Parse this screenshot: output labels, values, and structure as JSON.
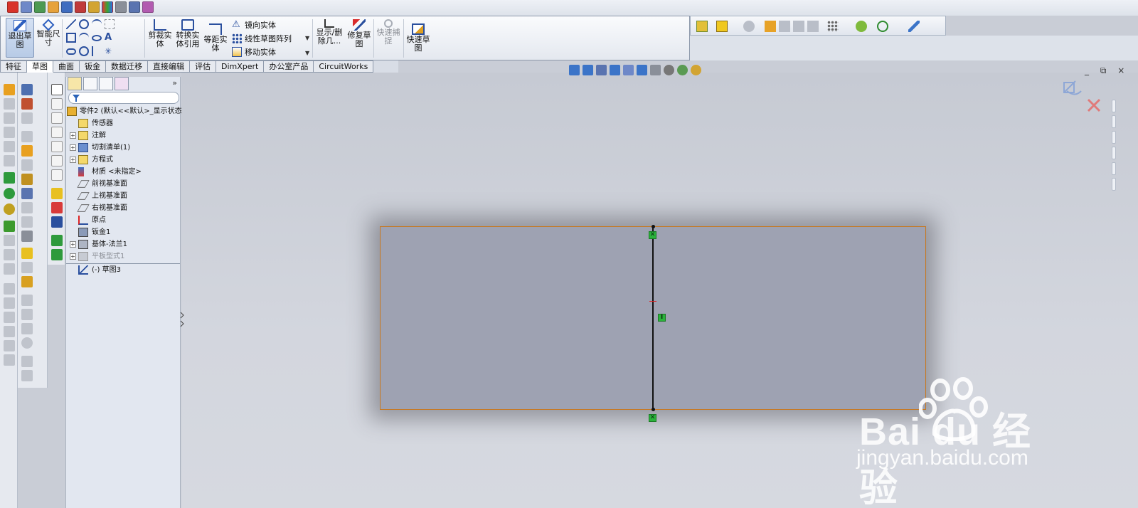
{
  "quick_access": {
    "icons": [
      "3d-icon",
      "part-icon",
      "assembly-icon",
      "tree-icon",
      "drawing-icon",
      "mate-icon",
      "toolbox-icon",
      "color-icon",
      "hole-icon",
      "chart-icon",
      "measure-icon"
    ]
  },
  "ribbon": {
    "exit_sketch": "退出草图",
    "smart_dimension": "智能尺寸",
    "trim_entities": "剪裁实体",
    "convert_entities": "转换实体引用",
    "offset_entities": "等距实体",
    "mirror_entities": "镜向实体",
    "linear_pattern": "线性草图阵列",
    "move_entities": "移动实体",
    "display_delete": "显示/删除几...",
    "repair_sketch": "修复草图",
    "quick_snaps": "快速捕捉",
    "rapid_sketch": "快速草图"
  },
  "tabs": [
    "特征",
    "草图",
    "曲面",
    "钣金",
    "数据迁移",
    "直接编辑",
    "评估",
    "DimXpert",
    "办公室产品",
    "CircuitWorks"
  ],
  "selected_tab": "草图",
  "feature_tree": {
    "more": "»",
    "root": "零件2 (默认<<默认>_显示状态",
    "items": [
      {
        "label": "传感器",
        "icon": "sensor-icon",
        "expandable": false
      },
      {
        "label": "注解",
        "icon": "annotation-icon",
        "expandable": true
      },
      {
        "label": "切割清单(1)",
        "icon": "cutlist-icon",
        "expandable": true
      },
      {
        "label": "方程式",
        "icon": "equation-icon",
        "expandable": true
      },
      {
        "label": "材质 <未指定>",
        "icon": "material-icon",
        "expandable": false
      },
      {
        "label": "前视基准面",
        "icon": "plane-icon",
        "expandable": false
      },
      {
        "label": "上视基准面",
        "icon": "plane-icon",
        "expandable": false
      },
      {
        "label": "右视基准面",
        "icon": "plane-icon",
        "expandable": false
      },
      {
        "label": "原点",
        "icon": "origin-icon",
        "expandable": false
      },
      {
        "label": "钣金1",
        "icon": "sheetmetal-icon",
        "expandable": false
      },
      {
        "label": "基体-法兰1",
        "icon": "base-flange-icon",
        "expandable": true
      },
      {
        "label": "平板型式1",
        "icon": "flat-pattern-icon",
        "expandable": true,
        "suppressed": true
      }
    ],
    "active_sketch": "(-) 草图3"
  },
  "view_toolbar": {
    "icons": [
      "zoom-fit-icon",
      "zoom-area-icon",
      "previous-view-icon",
      "section-view-icon",
      "view-orientation-icon",
      "display-style-icon",
      "hide-show-icon",
      "appearance-icon",
      "scene-icon",
      "view-settings-icon"
    ]
  },
  "window_controls": "_ ⧉ ×",
  "watermark": {
    "logo": "Bai  du 经验",
    "url": "jingyan.baidu.com"
  },
  "colors": {
    "sheet_fill": "#9ea2b2",
    "sheet_edge": "#c77820",
    "relation_green": "#2bb23b",
    "background": "#c9cdd6"
  }
}
